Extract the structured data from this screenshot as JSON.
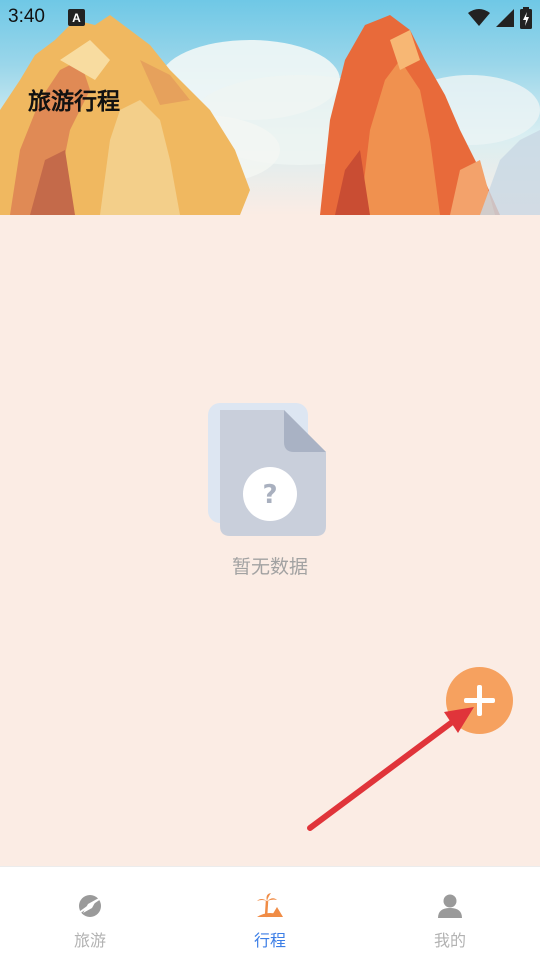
{
  "status_bar": {
    "time": "3:40",
    "icons": [
      "notification-a-icon",
      "wifi-icon",
      "signal-icon",
      "battery-charging-icon"
    ]
  },
  "header": {
    "title": "旅游行程"
  },
  "empty_state": {
    "icon": "empty-document-question-icon",
    "text": "暂无数据"
  },
  "fab": {
    "icon": "plus-icon",
    "color": "#f6a15f"
  },
  "bottom_nav": {
    "items": [
      {
        "label": "旅游",
        "icon": "travel-compass-icon",
        "active": false
      },
      {
        "label": "行程",
        "icon": "palm-beach-icon",
        "active": true
      },
      {
        "label": "我的",
        "icon": "person-icon",
        "active": false
      }
    ],
    "active_color": "#3c7ee6",
    "inactive_color": "#b2b2b2"
  },
  "colors": {
    "background": "#fbece4",
    "annotation_arrow": "#e0343a"
  }
}
